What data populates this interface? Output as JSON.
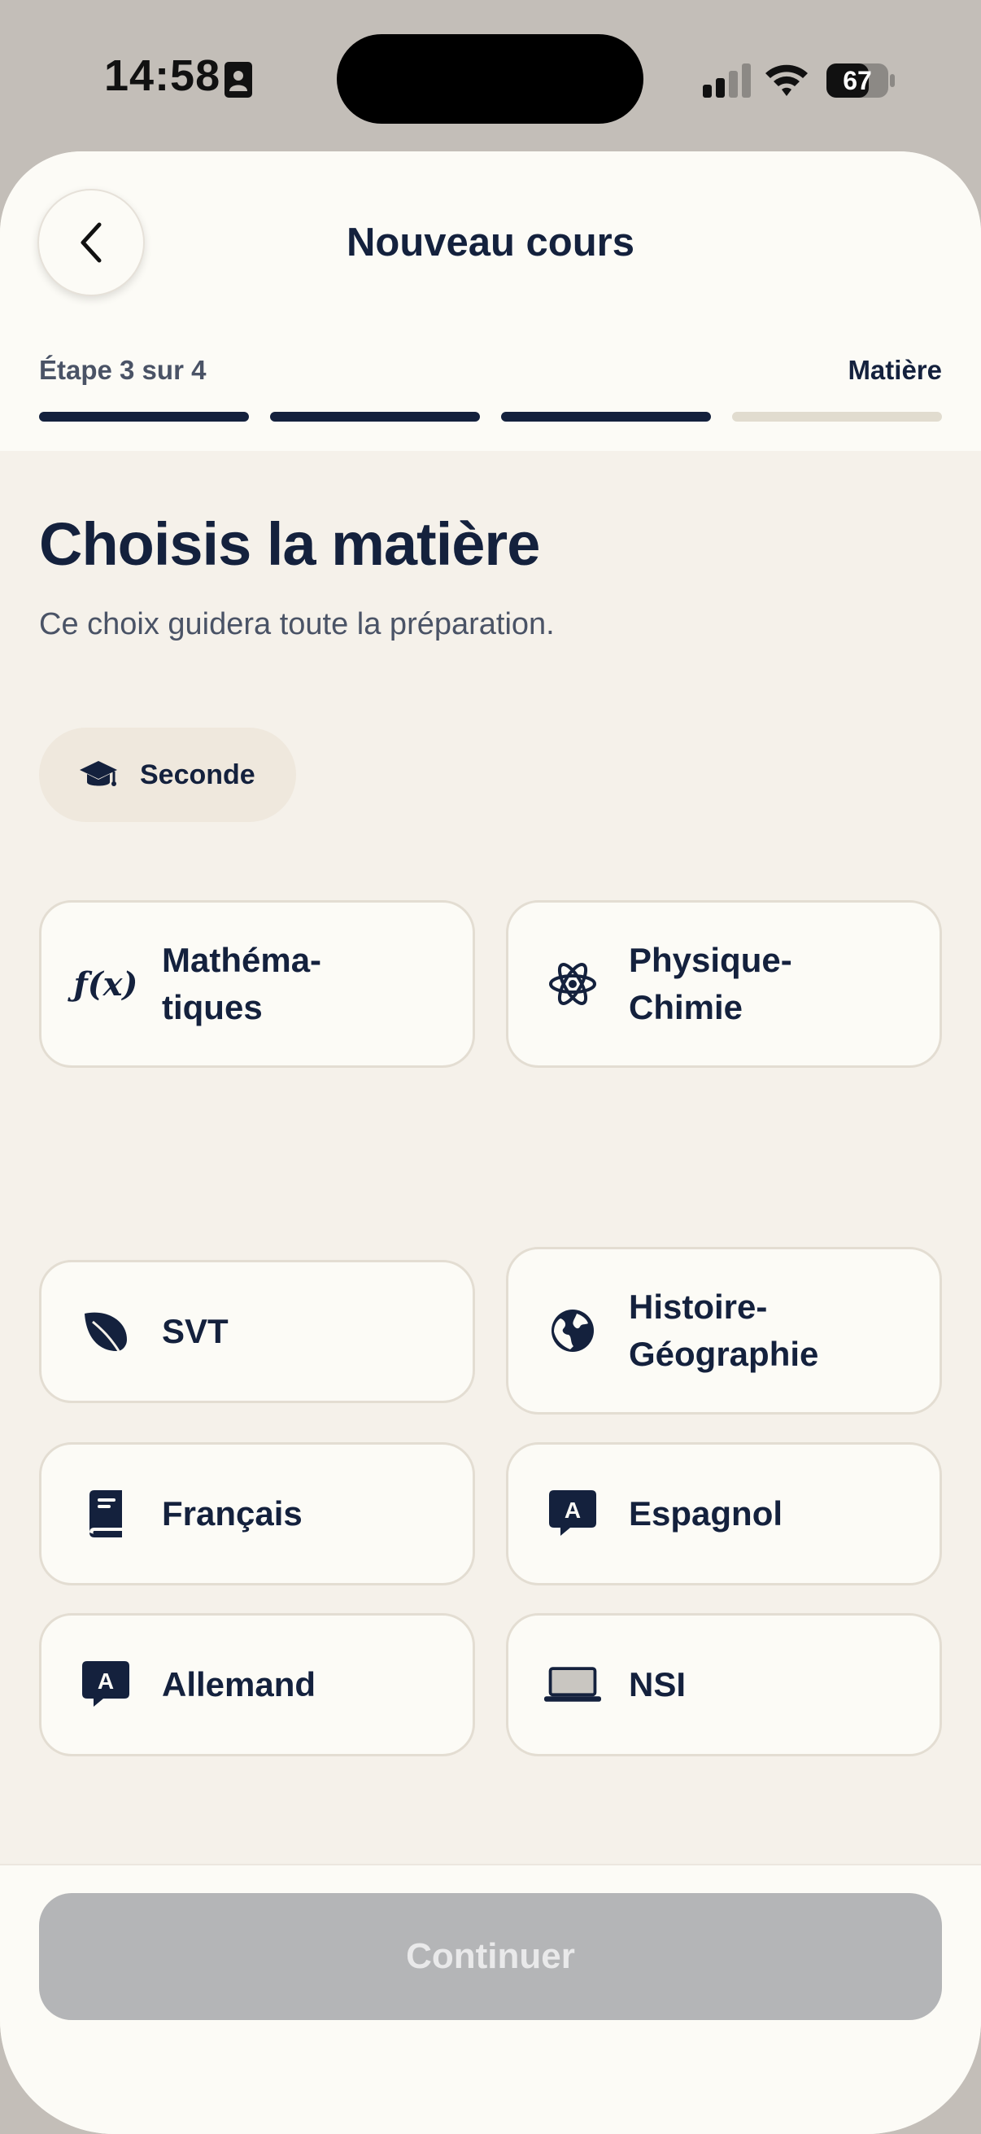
{
  "status_bar": {
    "time": "14:58",
    "battery": "67"
  },
  "header": {
    "title": "Nouveau cours",
    "back_icon": "chevron-left-icon"
  },
  "progress": {
    "step_label": "Étape 3 sur 4",
    "step_name": "Matière",
    "current_step": 3,
    "total_steps": 4
  },
  "main": {
    "heading": "Choisis la matière",
    "subheading": "Ce choix guidera toute la préparation.",
    "level_chip": {
      "label": "Seconde",
      "icon": "graduation-cap-icon"
    },
    "subjects": [
      {
        "label": "Mathéma-\ntiques",
        "icon": "function-icon"
      },
      {
        "label": "Physique-\nChimie",
        "icon": "atom-icon"
      },
      {
        "label": "SVT",
        "icon": "leaf-icon"
      },
      {
        "label": "Histoire-\nGéographie",
        "icon": "globe-icon"
      },
      {
        "label": "Français",
        "icon": "book-icon"
      },
      {
        "label": "Espagnol",
        "icon": "language-bubble-icon"
      },
      {
        "label": "Allemand",
        "icon": "language-bubble-icon"
      },
      {
        "label": "NSI",
        "icon": "laptop-icon"
      }
    ]
  },
  "footer": {
    "continue_label": "Continuer"
  },
  "colors": {
    "primary": "#14213d",
    "background": "#f5f1ea",
    "surface": "#fcfbf6",
    "disabled_button": "#b4b5b7"
  }
}
